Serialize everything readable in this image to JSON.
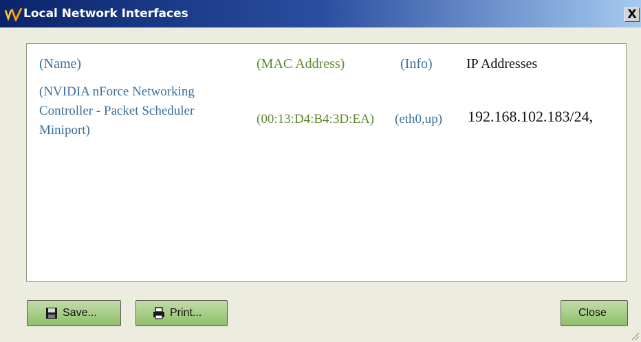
{
  "window": {
    "title": "Local Network Interfaces",
    "close_glyph": "X"
  },
  "table": {
    "headers": {
      "name": "(Name)",
      "mac": "(MAC Address)",
      "info": "(Info)",
      "ip": "IP Addresses"
    },
    "rows": [
      {
        "name_lines": [
          "(NVIDIA nForce Networking",
          "Controller - Packet Scheduler",
          "Miniport)"
        ],
        "mac": "(00:13:D4:B4:3D:EA)",
        "info": "(eth0,up)",
        "ip": "192.168.102.183/24,"
      }
    ]
  },
  "buttons": {
    "save": "Save...",
    "print": "Print...",
    "close": "Close"
  },
  "icons": {
    "app_logo": "nv-logo-icon",
    "save": "floppy-disk-icon",
    "print": "printer-icon"
  },
  "colors": {
    "name_blue": "#3d6e9a",
    "mac_green": "#5c8a2c",
    "button_green": "#a8cf86"
  }
}
